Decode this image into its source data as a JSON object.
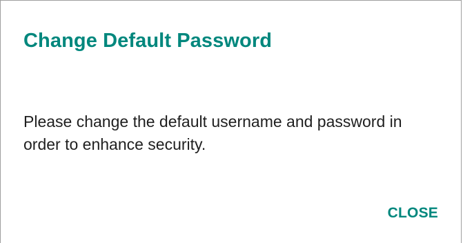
{
  "dialog": {
    "title": "Change Default Password",
    "message": "Please change the default username and password in order to enhance security.",
    "close_label": "CLOSE"
  },
  "colors": {
    "accent": "#00877d",
    "text": "#1f1f1f",
    "border": "#9e9e9e"
  }
}
